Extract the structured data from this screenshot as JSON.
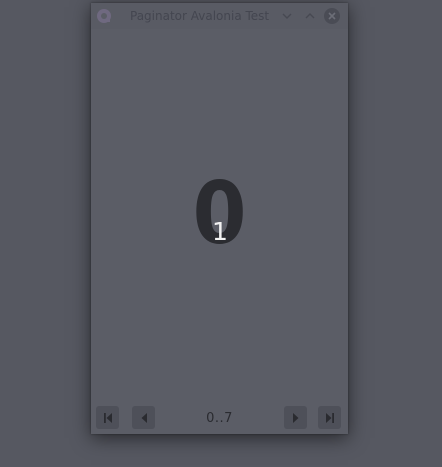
{
  "window": {
    "title": "Paginator Avalonia Test",
    "minimize_glyph": "﹀",
    "maximize_glyph": "︿",
    "close_glyph": "✕"
  },
  "content": {
    "current_page": "0",
    "overlay_number": "1"
  },
  "pager": {
    "range_text": "0..7",
    "buttons": [
      "first-page",
      "previous-page",
      "next-page",
      "last-page"
    ]
  },
  "colors": {
    "desktop": "#565861",
    "window": "#5b5d66",
    "button": "#4e5059",
    "big_number": "#2b2c31",
    "overlay_number": "#f2f2f2"
  }
}
